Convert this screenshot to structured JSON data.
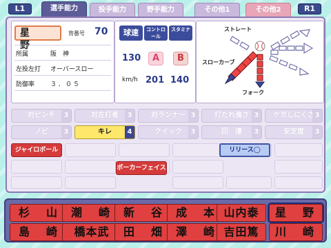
{
  "buttons": {
    "l1": "L1",
    "r1": "R1"
  },
  "tabs": [
    {
      "label": "選手能力",
      "state": "active"
    },
    {
      "label": "投手能力",
      "state": "normal"
    },
    {
      "label": "野手能力",
      "state": "normal"
    },
    {
      "label": "その他1",
      "state": "normal"
    },
    {
      "label": "その他2",
      "state": "pink"
    }
  ],
  "player": {
    "name": "星　野",
    "number_label": "背番号",
    "number": "70",
    "team_label": "所属",
    "team": "阪　神",
    "throw_label": "左投左打",
    "throw": "オーバースロー",
    "era_label": "防御率",
    "era": "３．０５"
  },
  "stats": {
    "speed_label": "球速",
    "control_label": "コントロール",
    "stamina_label": "スタミナ",
    "speed": "130",
    "control_grade": "A",
    "stamina_grade": "B",
    "unit": "km/h",
    "control_value": "201",
    "stamina_value": "140"
  },
  "pitches": {
    "straight": "ストレート",
    "slow_curve": "スローカーブ",
    "fork": "フォーク",
    "straight_level": null,
    "slow_curve_level": 5,
    "fork_level": 4
  },
  "skills": [
    {
      "label": "対ピンチ",
      "level": "3",
      "active": false
    },
    {
      "label": "対左打者",
      "level": "3",
      "active": false
    },
    {
      "label": "対ランナー",
      "level": "3",
      "active": false
    },
    {
      "label": "打たれ強さ",
      "level": "3",
      "active": false
    },
    {
      "label": "ケガしにくさ",
      "level": "3",
      "active": false
    },
    {
      "label": "ノビ",
      "level": "3",
      "active": false
    },
    {
      "label": "キレ",
      "level": "4",
      "active": true
    },
    {
      "label": "クイック",
      "level": "3",
      "active": false
    },
    {
      "label": "回　復",
      "level": "3",
      "active": false
    },
    {
      "label": "安定度",
      "level": "3",
      "active": false
    }
  ],
  "abilities": {
    "gyro": "ジャイロボール",
    "release": "リリース◯",
    "poker": "ポーカーフェイス"
  },
  "roster": [
    "杉　山",
    "潮　崎",
    "新　谷",
    "成　本",
    "山内泰",
    "星　野",
    "島　崎",
    "橋本武",
    "田　畑",
    "澤　崎",
    "吉田篤",
    "川　崎"
  ]
}
